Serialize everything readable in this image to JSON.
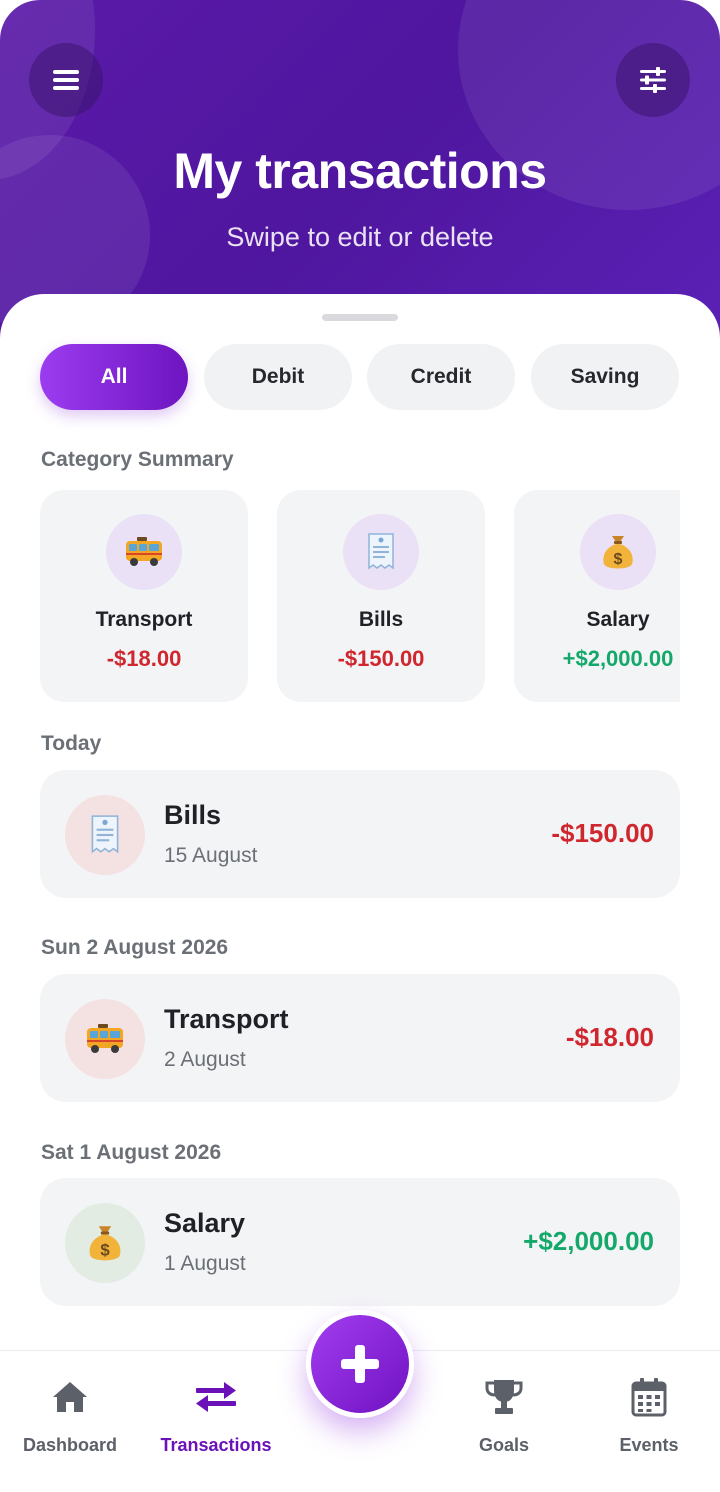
{
  "header": {
    "title": "My transactions",
    "subtitle": "Swipe to edit or delete",
    "menu_icon": "menu-icon",
    "filter_icon": "sliders-icon"
  },
  "filters": [
    {
      "label": "All",
      "active": true
    },
    {
      "label": "Debit",
      "active": false
    },
    {
      "label": "Credit",
      "active": false
    },
    {
      "label": "Saving",
      "active": false
    }
  ],
  "category_summary": {
    "label": "Category Summary",
    "items": [
      {
        "name": "Transport",
        "amount": "-$18.00",
        "icon": "bus-icon",
        "type": "negative"
      },
      {
        "name": "Bills",
        "amount": "-$150.00",
        "icon": "receipt-icon",
        "type": "negative"
      },
      {
        "name": "Salary",
        "amount": "+$2,000.00",
        "icon": "money-bag-icon",
        "type": "positive"
      }
    ]
  },
  "groups": [
    {
      "label": "Today",
      "transactions": [
        {
          "name": "Bills",
          "date": "15 August",
          "amount": "-$150.00",
          "icon": "receipt-icon",
          "type": "negative"
        }
      ]
    },
    {
      "label": "Sun 2 August 2026",
      "transactions": [
        {
          "name": "Transport",
          "date": "2 August",
          "amount": "-$18.00",
          "icon": "bus-icon",
          "type": "negative"
        }
      ]
    },
    {
      "label": "Sat 1 August 2026",
      "transactions": [
        {
          "name": "Salary",
          "date": "1 August",
          "amount": "+$2,000.00",
          "icon": "money-bag-icon",
          "type": "positive"
        }
      ]
    }
  ],
  "bottom_nav": {
    "items": [
      {
        "label": "Dashboard",
        "icon": "home-icon",
        "active": false
      },
      {
        "label": "Transactions",
        "icon": "swap-arrows-icon",
        "active": true
      },
      {
        "label": "Goals",
        "icon": "trophy-icon",
        "active": false
      },
      {
        "label": "Events",
        "icon": "calendar-icon",
        "active": false
      }
    ],
    "fab_icon": "plus-icon"
  },
  "colors": {
    "header_bg": "#4f169f",
    "accent": "#6e14c0",
    "negative": "#d0262e",
    "positive": "#14a86a"
  }
}
